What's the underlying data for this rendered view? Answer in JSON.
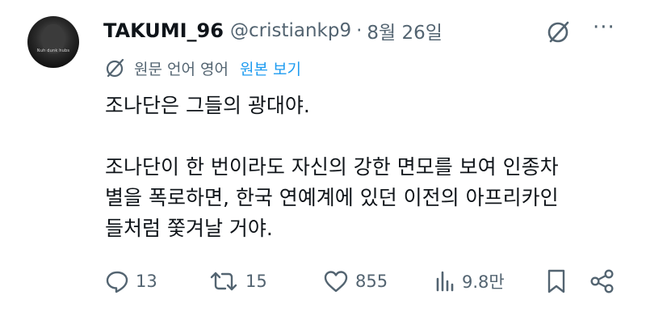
{
  "author": {
    "display_name": "TAKUMI_96",
    "handle": "@cristiankp9",
    "separator": "·",
    "date": "8월 26일",
    "avatar_caption": "Nuh dunk hubs"
  },
  "icons": {
    "grok": "grok-icon",
    "more": "more-icon",
    "translate": "translate-icon",
    "reply": "reply-icon",
    "retweet": "retweet-icon",
    "like": "like-icon",
    "views": "views-icon",
    "bookmark": "bookmark-icon",
    "share": "share-icon"
  },
  "more_label": "···",
  "translation": {
    "note": "원문 언어 영어",
    "link": "원본 보기"
  },
  "tweet": {
    "line1": "조나단은 그들의 광대야.",
    "line2": "조나단이 한 번이라도 자신의 강한 면모를 보여 인종차",
    "line3": "별을 폭로하면, 한국 연예계에 있던 이전의 아프리카인",
    "line4": "들처럼 쫓겨날 거야."
  },
  "actions": {
    "replies": "13",
    "retweets": "15",
    "likes": "855",
    "views": "9.8만"
  },
  "colors": {
    "text": "#0f1419",
    "muted": "#536471",
    "link": "#1d9bf0",
    "background": "#ffffff"
  }
}
